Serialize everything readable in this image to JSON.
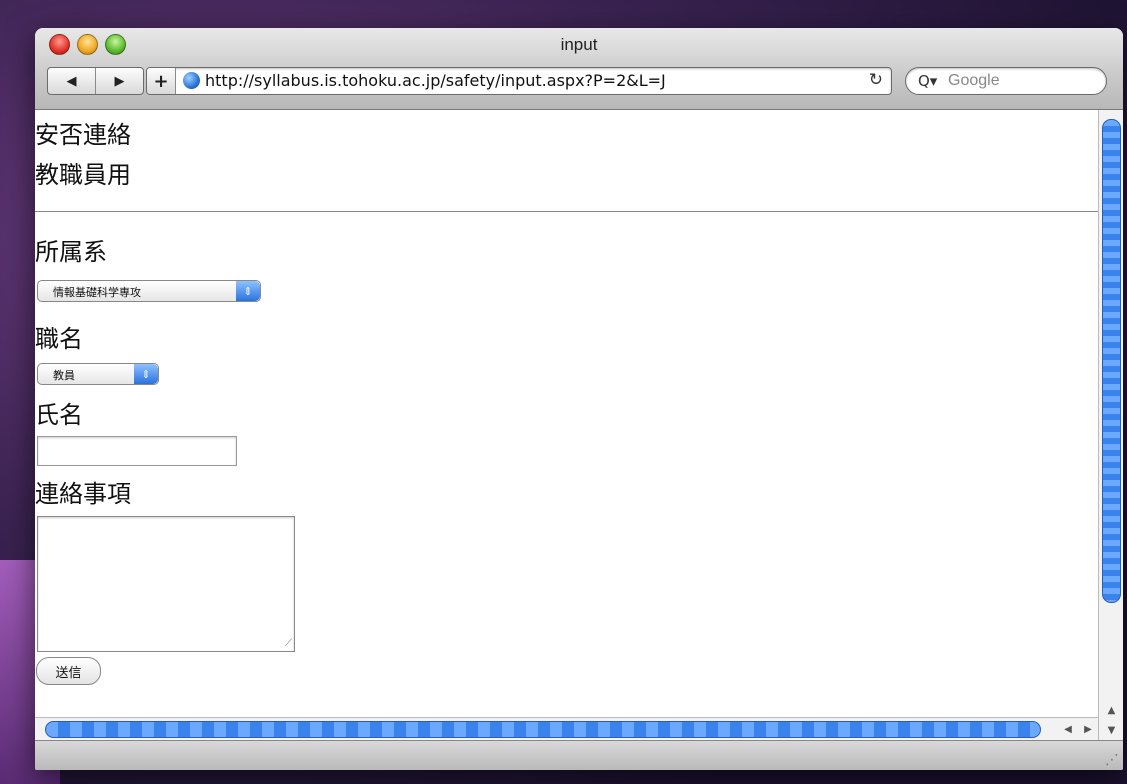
{
  "window": {
    "title": "input"
  },
  "toolbar": {
    "back_glyph": "◀",
    "forward_glyph": "▶",
    "add_glyph": "+",
    "url": "http://syllabus.is.tohoku.ac.jp/safety/input.aspx?P=2&L=J",
    "reload_glyph": "↻",
    "search_placeholder": "Google",
    "search_glyph": "Q▾"
  },
  "page": {
    "heading1": "安否連絡",
    "heading2": "教職員用",
    "affiliation_label": "所属系",
    "affiliation_value": "情報基礎科学専攻",
    "position_label": "職名",
    "position_value": "教員",
    "name_label": "氏名",
    "name_value": "",
    "message_label": "連絡事項",
    "message_value": "",
    "submit_label": "送信"
  },
  "scroll": {
    "up": "▲",
    "down": "▼",
    "left": "◀",
    "right": "▶"
  },
  "colors": {
    "accent": "#3a83ec",
    "chrome": "#c9c9c9"
  }
}
